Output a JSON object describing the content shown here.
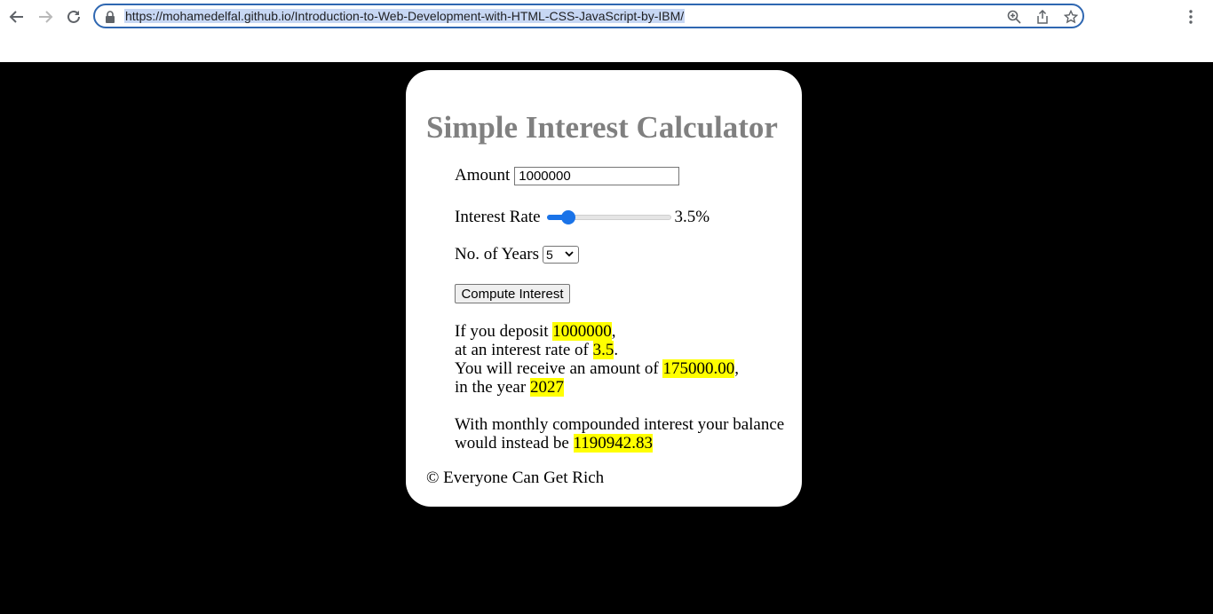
{
  "browser": {
    "url": "https://mohamedelfal.github.io/Introduction-to-Web-Development-with-HTML-CSS-JavaScript-by-IBM/",
    "accent": "#2f67b1"
  },
  "page": {
    "title": "Simple Interest Calculator",
    "amount": {
      "label": "Amount",
      "value": "1000000"
    },
    "rate": {
      "label": "Interest Rate",
      "value_text": "3.5%",
      "value": 3.5,
      "min": 1,
      "max": 20
    },
    "years": {
      "label": "No. of Years",
      "selected": "5"
    },
    "compute_button": "Compute Interest",
    "result": {
      "line1_prefix": "If you deposit ",
      "deposit": "1000000",
      "line1_suffix": ",",
      "line2_prefix": "at an interest rate of ",
      "rate": "3.5",
      "line2_suffix": ".",
      "line3_prefix": "You will receive an amount of ",
      "amount": "175000.00",
      "line3_suffix": ",",
      "line4_prefix": "in the year ",
      "year": "2027",
      "compound_line1": "With monthly compounded interest your balance",
      "compound_line2_prefix": "would instead be ",
      "compound_value": "1190942.83"
    },
    "footer": "© Everyone Can Get Rich",
    "highlight_color": "#ffff00",
    "title_color": "#808080"
  }
}
